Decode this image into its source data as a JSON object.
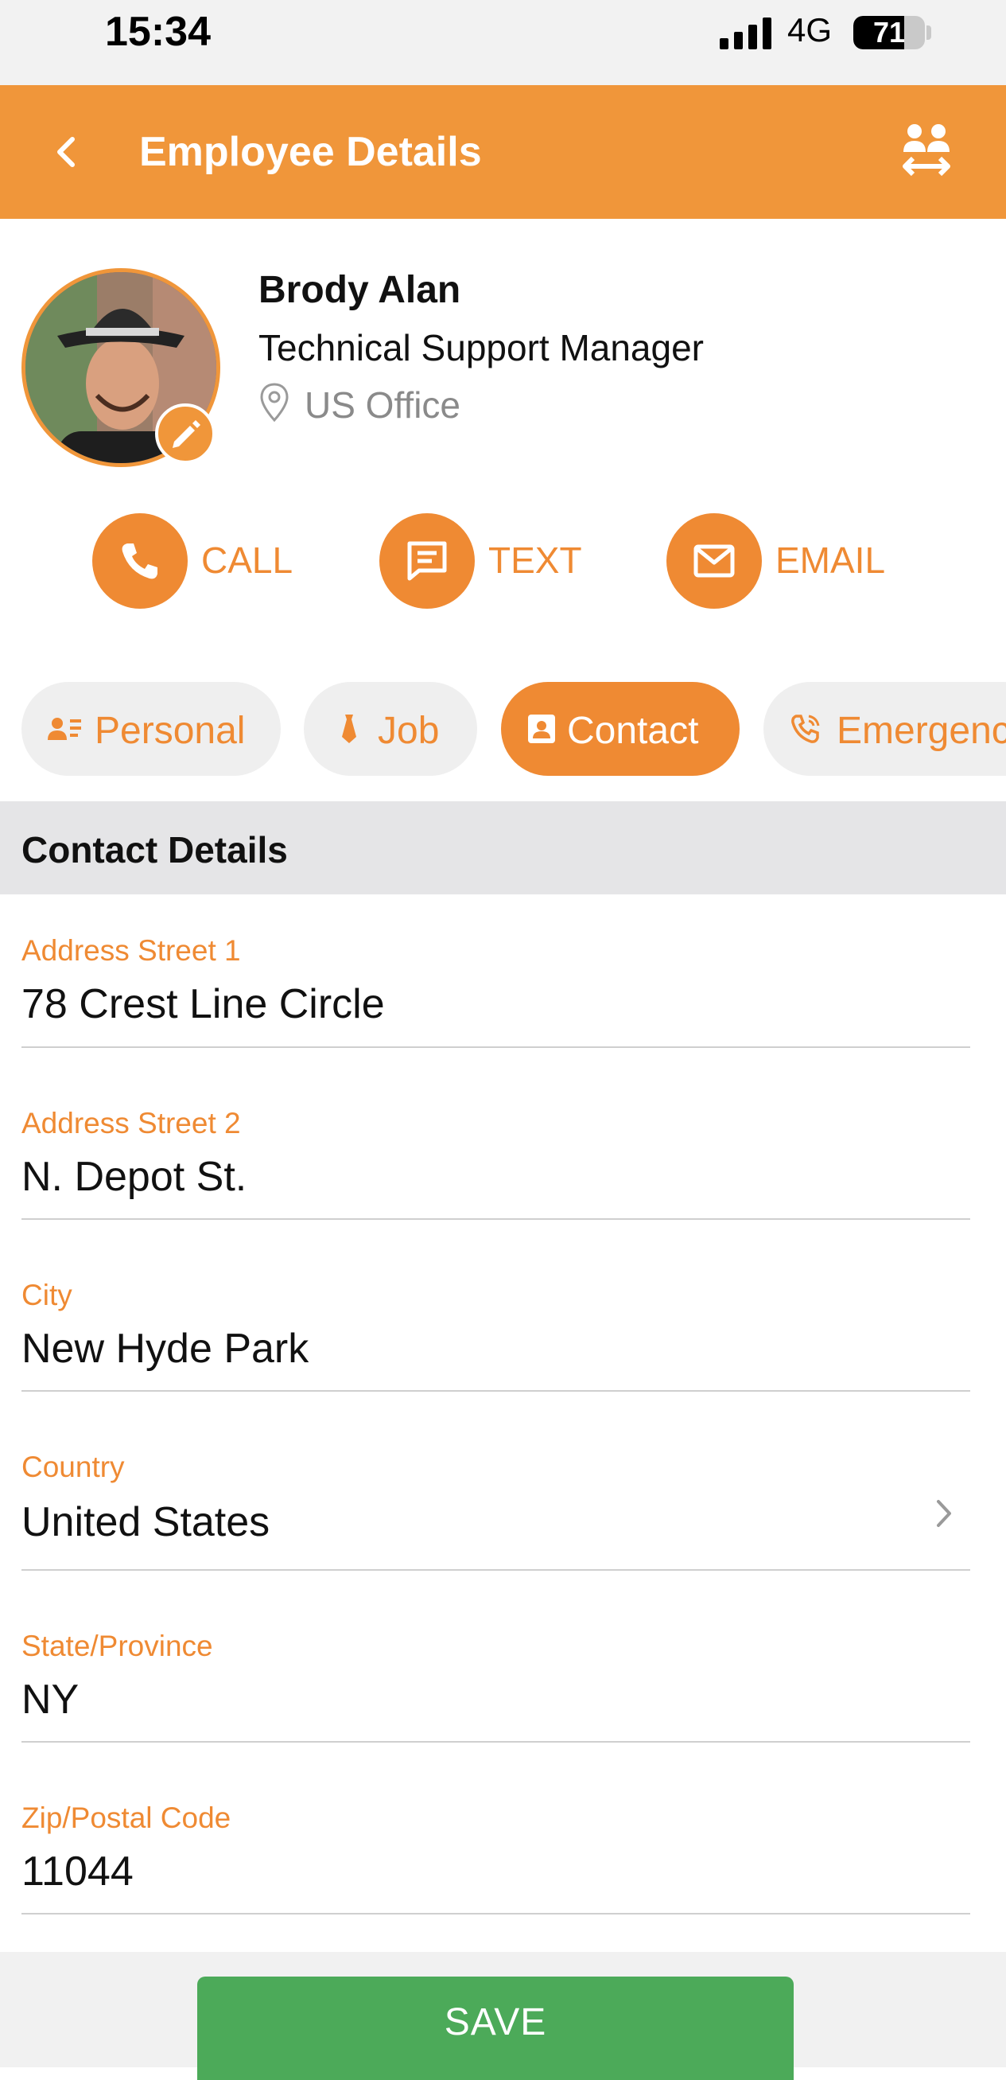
{
  "status_bar": {
    "time": "15:34",
    "network": "4G",
    "battery": "71",
    "battery_level": 0.71
  },
  "app_bar": {
    "title": "Employee Details"
  },
  "profile": {
    "name": "Brody Alan",
    "job_title": "Technical Support Manager",
    "location": "US Office"
  },
  "actions": {
    "call": "CALL",
    "text": "TEXT",
    "email": "EMAIL"
  },
  "tabs": [
    {
      "label": "Personal"
    },
    {
      "label": "Job"
    },
    {
      "label": "Contact"
    },
    {
      "label": "Emergenc"
    }
  ],
  "section": {
    "title": "Contact Details"
  },
  "fields": {
    "street1": {
      "label": "Address Street 1",
      "value": "78 Crest Line Circle"
    },
    "street2": {
      "label": "Address Street 2",
      "value": "N. Depot St."
    },
    "city": {
      "label": "City",
      "value": "New Hyde Park"
    },
    "country": {
      "label": "Country",
      "value": "United States"
    },
    "state": {
      "label": "State/Province",
      "value": "NY"
    },
    "zip": {
      "label": "Zip/Postal Code",
      "value": "11044"
    }
  },
  "footer": {
    "save_label": "SAVE"
  },
  "colors": {
    "accent": "#f0963a",
    "save": "#4caa59",
    "section_bg": "#e5e5e7"
  }
}
